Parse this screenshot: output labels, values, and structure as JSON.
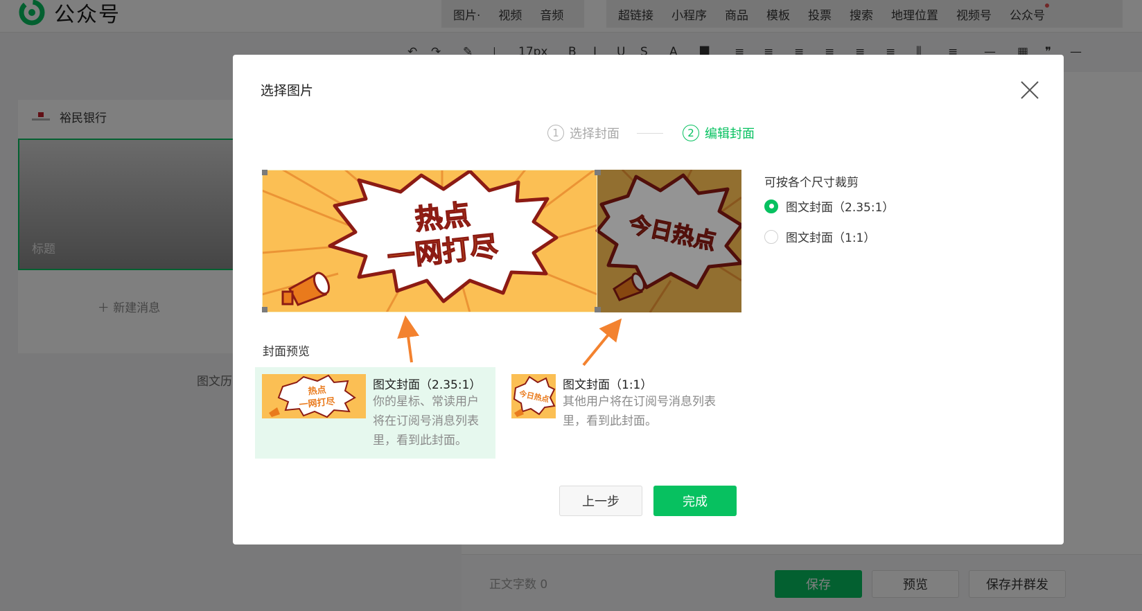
{
  "app": {
    "name": "公众号",
    "insert_menu": {
      "group1": [
        "图片·",
        "视频",
        "音频"
      ],
      "group2": [
        "超链接",
        "小程序",
        "商品",
        "模板",
        "投票",
        "搜索",
        "地理位置",
        "视频号",
        "公众号"
      ]
    },
    "format_toolbar": {
      "font_size": "17px"
    }
  },
  "sidebar": {
    "account_name": "裕民银行",
    "title_placeholder": "标题",
    "new_message": "＋ 新建消息",
    "history_label": "图文历"
  },
  "editor_footer": {
    "word_count": "正文字数 0",
    "save": "保存",
    "preview": "预览",
    "save_mass": "保存并群发"
  },
  "dialog": {
    "title": "选择图片",
    "steps": [
      {
        "num": "1",
        "label": "选择封面",
        "state": "inactive"
      },
      {
        "num": "2",
        "label": "编辑封面",
        "state": "active"
      }
    ],
    "crop_image": {
      "left_text_line1": "热点",
      "left_text_line2": "一网打尽",
      "right_text": "今日热点"
    },
    "crop_hint": "可按各个尺寸裁剪",
    "crop_options": [
      {
        "label": "图文封面（2.35:1）",
        "selected": true
      },
      {
        "label": "图文封面（1:1）",
        "selected": false
      }
    ],
    "preview_label": "封面预览",
    "previews": [
      {
        "title": "图文封面（2.35:1）",
        "desc_lines": [
          "你的星标、常读用户",
          "将在订阅号消息列表",
          "里，看到此封面。"
        ],
        "thumb_text_line1": "热点",
        "thumb_text_line2": "一网打尽"
      },
      {
        "title": "图文封面（1:1）",
        "desc_lines": [
          "其他用户将在订阅号消息列表",
          "里，看到此封面。"
        ],
        "thumb_text": "今日热点"
      }
    ],
    "prev_button": "上一步",
    "done_button": "完成"
  },
  "colors": {
    "accent": "#07c160",
    "poster_yellow": "#fbbf54",
    "poster_text": "#e97a1c",
    "annotation_arrow": "#f3822f"
  }
}
